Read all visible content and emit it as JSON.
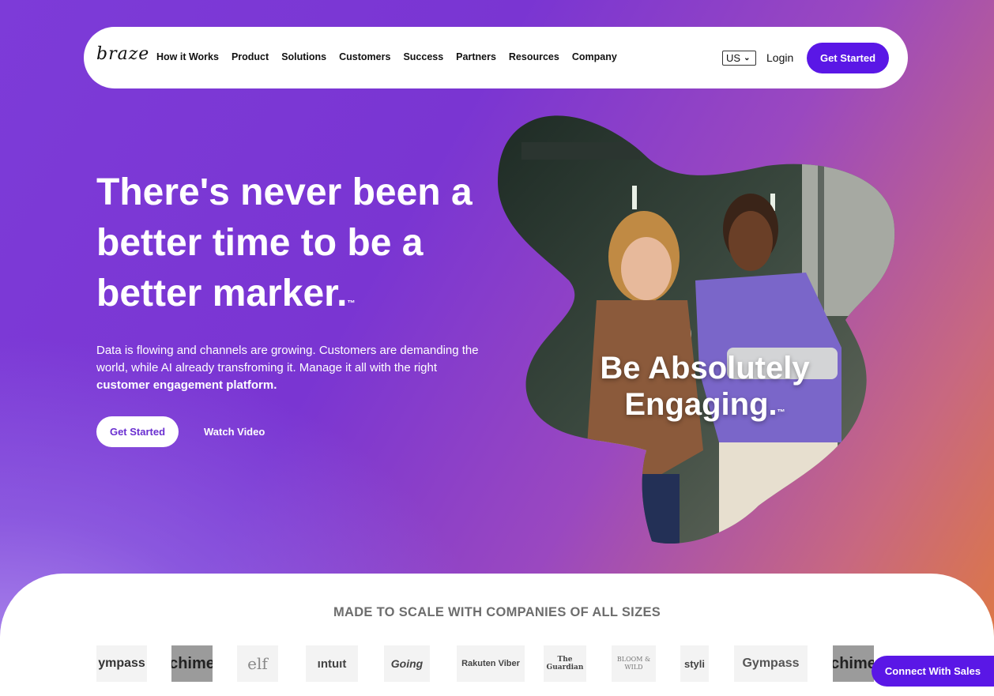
{
  "nav": {
    "logo": "braze",
    "links": [
      "How it Works",
      "Product",
      "Solutions",
      "Customers",
      "Success",
      "Partners",
      "Resources",
      "Company"
    ],
    "locale": "US",
    "login": "Login",
    "cta": "Get Started"
  },
  "hero": {
    "headline_l1": "There's never been a",
    "headline_l2": "better time to be a",
    "headline_l3": "better marker.",
    "tm": "™",
    "subcopy": "Data is flowing and channels are growing. Customers are demanding the world, while AI already transfroming it. Manage it all with the right",
    "subcopy_bold": "customer engagement platform.",
    "cta": "Get Started",
    "watch": "Watch Video",
    "image_l1": "Be Absolutely",
    "image_l2": "Engaging.",
    "image_tm": "™"
  },
  "customers": {
    "title": "MADE TO SCALE WITH COMPANIES OF ALL SIZES",
    "logos": [
      "ympass",
      "chime",
      "elf",
      "ıntuıt",
      "Going",
      "Rakuten Viber",
      "The Guardian",
      "BLOOM & WILD",
      "styli",
      "Gympass",
      "chime"
    ]
  },
  "connect": "Connect With Sales",
  "colors": {
    "brand_purple": "#5a17e6",
    "hero_start": "#7d3bd8",
    "hero_end": "#e07a3c"
  }
}
